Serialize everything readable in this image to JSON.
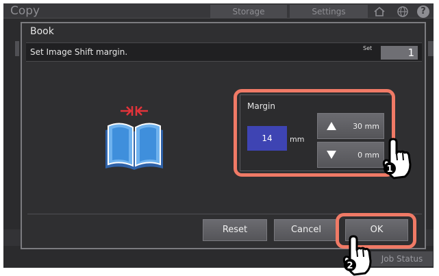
{
  "app": {
    "title": "Copy",
    "tabs": [
      "Storage",
      "Settings"
    ],
    "icons": [
      "home-icon",
      "globe-icon",
      "help-icon"
    ],
    "help_glyph": "?",
    "job_status_label": "Job Status"
  },
  "dialog": {
    "title": "Book",
    "instruction": "Set Image Shift margin.",
    "set_label": "Set",
    "set_value": "1"
  },
  "margin": {
    "label": "Margin",
    "value": "14",
    "unit": "mm",
    "max_label": "30 mm",
    "min_label": "0 mm"
  },
  "actions": {
    "reset_label": "Reset",
    "cancel_label": "Cancel",
    "ok_label": "OK"
  },
  "callouts": {
    "step_1": "1",
    "step_2": "2",
    "highlight_color": "#f07a66"
  },
  "colors": {
    "value_box": "#3e44b3",
    "dialog_bg": "#2f2f31",
    "book_blue": "#4a8fd8",
    "arrow_red": "#e2333a"
  }
}
